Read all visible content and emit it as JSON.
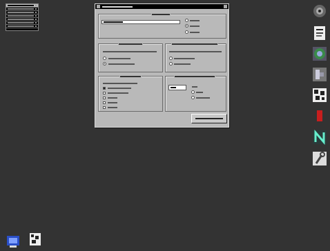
{
  "menu_panel": {
    "items": [
      {
        "label": "",
        "selected": true
      },
      {
        "label": "",
        "selected": false
      },
      {
        "label": "",
        "selected": false
      },
      {
        "label": "",
        "selected": false
      },
      {
        "label": "",
        "selected": false
      },
      {
        "label": "",
        "selected": false
      },
      {
        "label": "",
        "selected": false
      }
    ]
  },
  "dialog": {
    "title": "",
    "main_group": {
      "title": "",
      "input_value": "",
      "options": [
        {
          "label": "",
          "selected": false
        },
        {
          "label": "",
          "selected": true
        },
        {
          "label": "",
          "selected": false
        }
      ]
    },
    "left_group_1": {
      "title": "",
      "text": "",
      "options": [
        {
          "label": "",
          "selected": false
        },
        {
          "label": "",
          "selected": true
        }
      ]
    },
    "right_group_1": {
      "title": "",
      "text": "",
      "options": [
        {
          "label": "",
          "selected": false
        },
        {
          "label": "",
          "selected": false
        }
      ]
    },
    "left_group_2": {
      "title": "",
      "text": "",
      "checkboxes": [
        {
          "label": "",
          "checked": true
        },
        {
          "label": "",
          "checked": false
        },
        {
          "label": "",
          "checked": false
        },
        {
          "label": "",
          "checked": false
        },
        {
          "label": "",
          "checked": false
        }
      ]
    },
    "right_group_2": {
      "title": "",
      "input_value": "",
      "options": [
        {
          "label": "",
          "selected": false
        },
        {
          "label": "",
          "selected": false
        },
        {
          "label": "",
          "selected": false
        }
      ]
    },
    "action_button_label": ""
  },
  "dock": {
    "icons": [
      "disc-icon",
      "document-icon",
      "globe-icon",
      "tool-icon",
      "grid-icon",
      "red-app-icon",
      "n-logo-icon",
      "wrench-icon"
    ]
  },
  "desktop_icons": [
    "computer-icon",
    "trash-icon"
  ],
  "colors": {
    "desktop": "#333333",
    "dialog_bg": "#b9b9b9",
    "titlebar": "#000000"
  }
}
